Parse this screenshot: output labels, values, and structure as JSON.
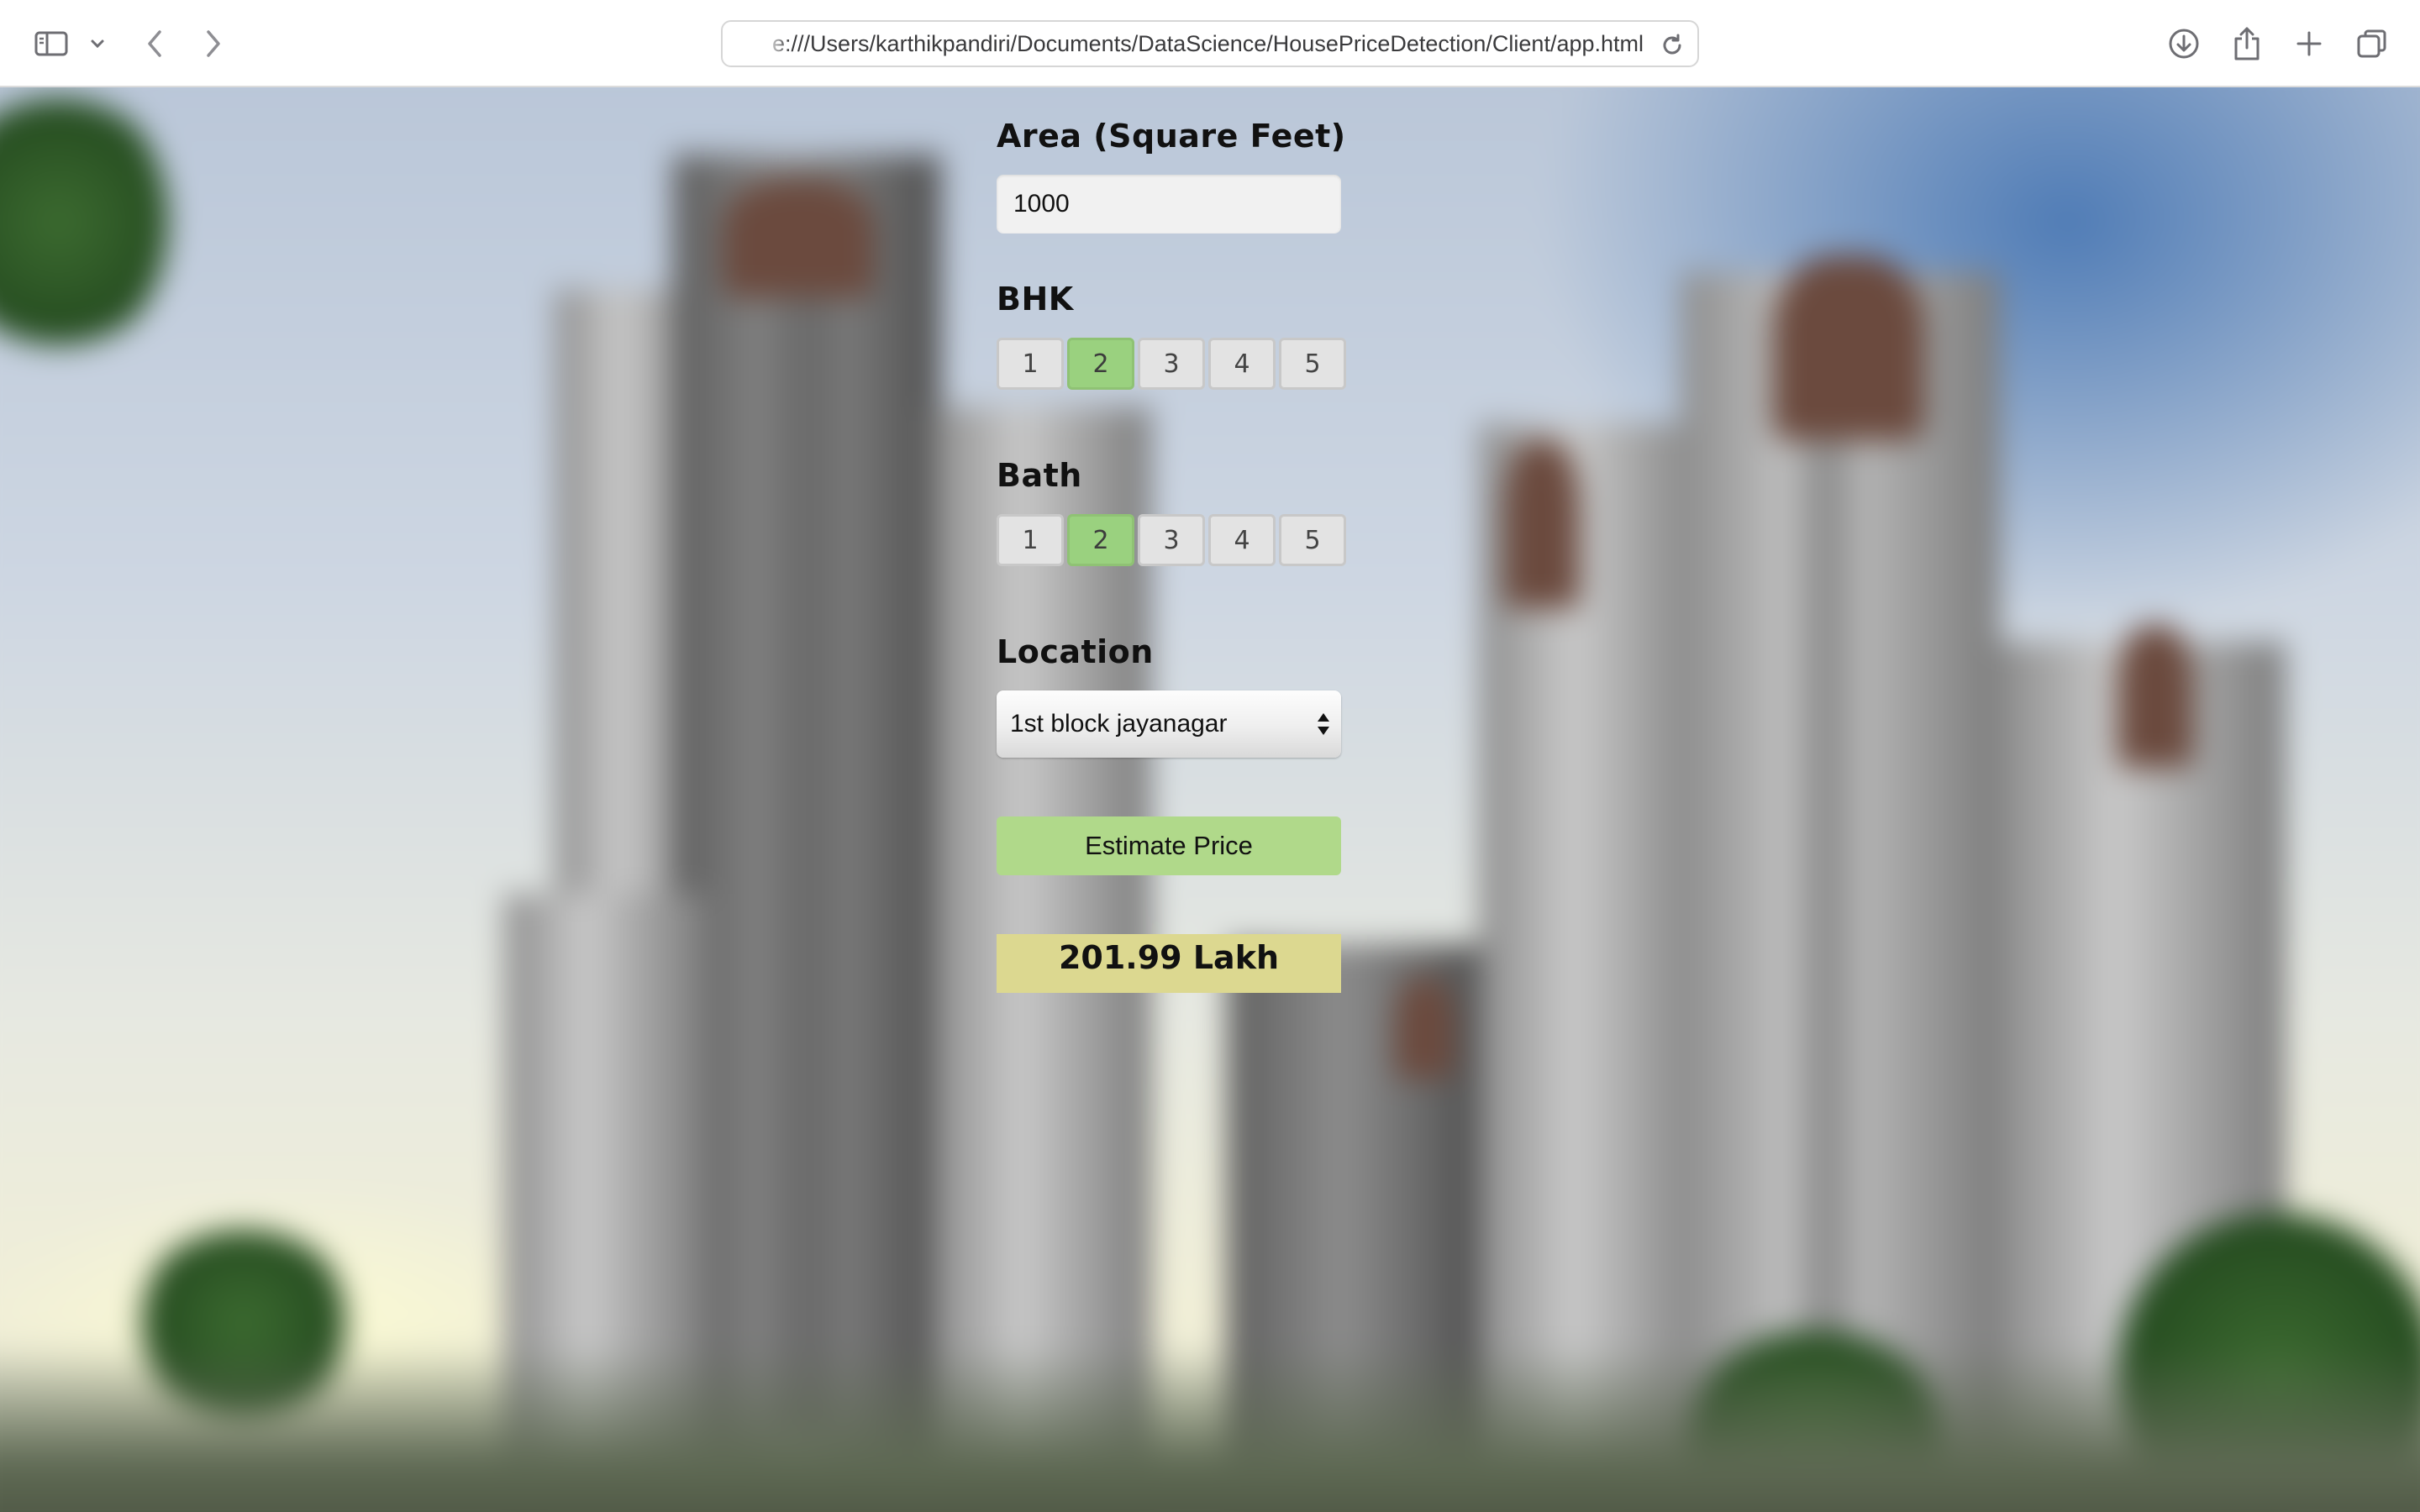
{
  "browser": {
    "url": "e:///Users/karthikpandiri/Documents/DataScience/HousePriceDetection/Client/app.html",
    "icons": {
      "sidebar": "sidebar-icon",
      "sidebar_menu": "chevron-down-icon",
      "back": "chevron-left-icon",
      "forward": "chevron-right-icon",
      "reload": "reload-icon",
      "download": "download-icon",
      "share": "share-icon",
      "new_tab": "plus-icon",
      "tabs": "tab-overview-icon"
    }
  },
  "form": {
    "area_label": "Area (Square Feet)",
    "area_value": "1000",
    "bhk_label": "BHK",
    "bhk_options": [
      "1",
      "2",
      "3",
      "4",
      "5"
    ],
    "bhk_selected": "2",
    "bath_label": "Bath",
    "bath_options": [
      "1",
      "2",
      "3",
      "4",
      "5"
    ],
    "bath_selected": "2",
    "location_label": "Location",
    "location_value": "1st block jayanagar",
    "estimate_button": "Estimate Price",
    "result": "201.99 Lakh"
  },
  "colors": {
    "selected_option": "#9ad17f",
    "estimate_button": "#b0d98a",
    "result_background": "#dcd890"
  }
}
